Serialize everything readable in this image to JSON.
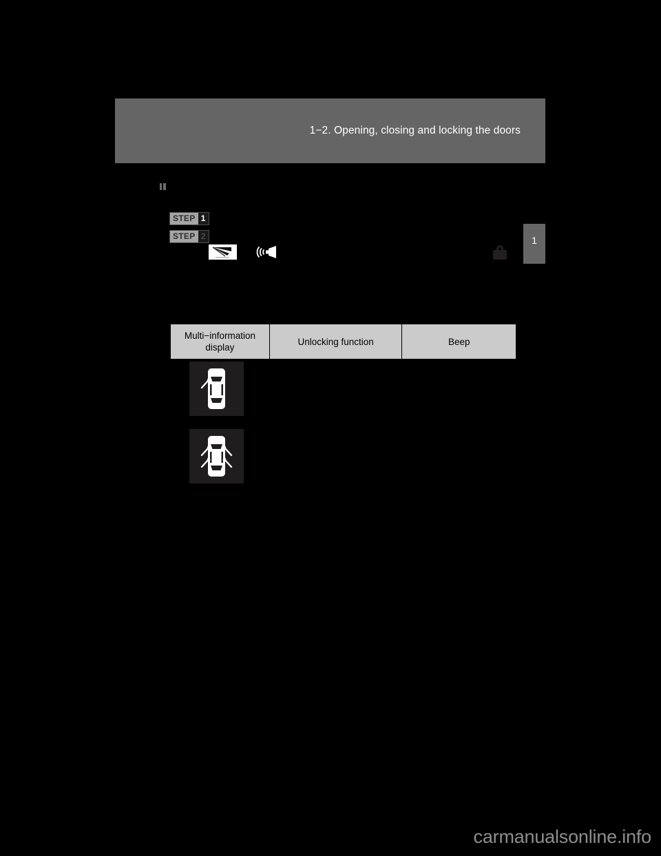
{
  "page": {
    "background_color": "#000000",
    "header": {
      "band_color": "#656565",
      "title": "1−2. Opening, closing and locking the doors"
    },
    "side_tab": {
      "chapter_number": "1",
      "color": "#656565"
    },
    "lock_icon_name": "padlock-icon",
    "section_mark_name": "section-bullet-mark"
  },
  "steps": [
    {
      "word": "STEP",
      "number": "1"
    },
    {
      "word": "STEP",
      "number": "2"
    }
  ],
  "pictograms": [
    {
      "name": "wiper-blade-icon"
    },
    {
      "name": "speaker-beep-icon"
    }
  ],
  "table": {
    "headers": [
      "Multi−information display",
      "Unlocking function",
      "Beep"
    ],
    "header_line_1": "Multi−information",
    "header_line_2": "display",
    "header_bg": "#cbcbcb",
    "border_color": "#000000"
  },
  "display_icons": [
    {
      "name": "car-driver-door-unlock-icon",
      "description": "Top view of car with one arrow at driver door",
      "tile_bg": "#1f1d1e"
    },
    {
      "name": "car-all-doors-unlock-icon",
      "description": "Top view of car with arrows at all four doors",
      "tile_bg": "#1f1d1e"
    }
  ],
  "watermark": {
    "text": "carmanualsonline.info",
    "color": "#8d8d8d"
  }
}
